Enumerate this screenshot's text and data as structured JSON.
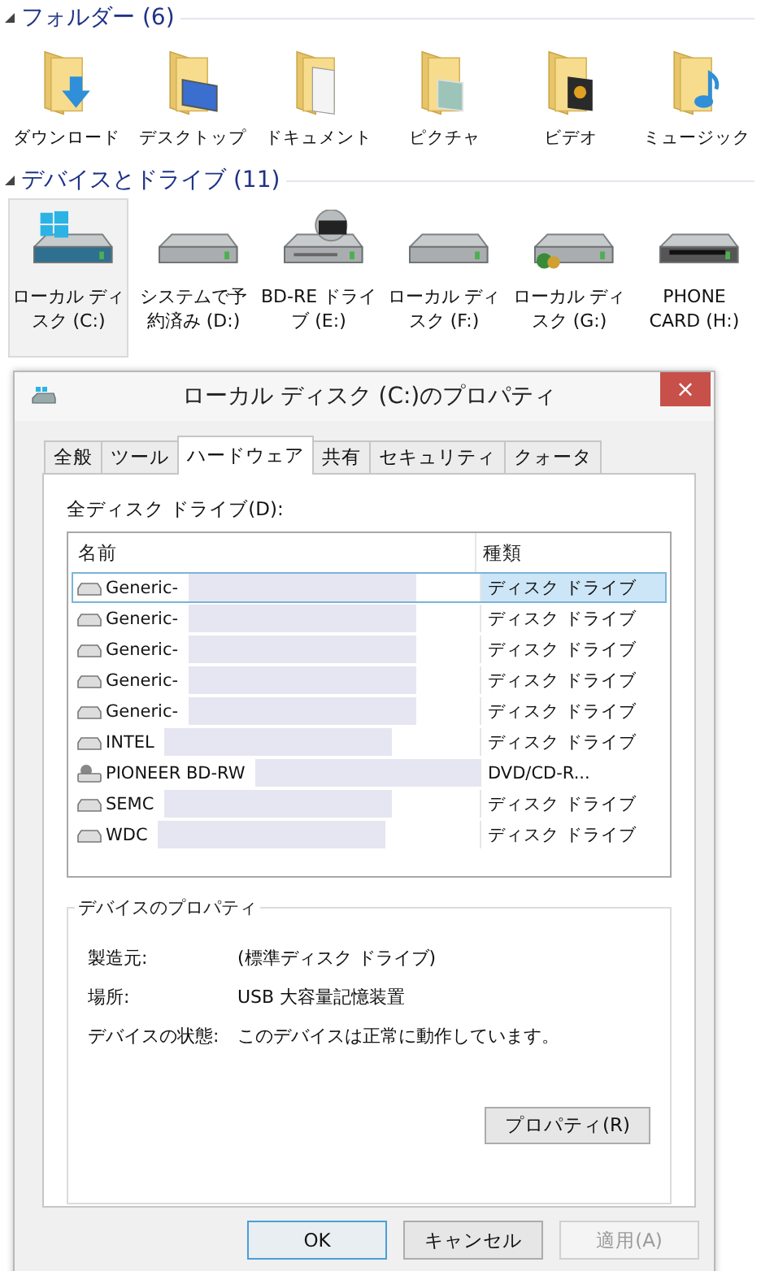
{
  "folders_section": {
    "title": "フォルダー (6)",
    "expanded": true,
    "items": [
      {
        "label": "ダウンロード",
        "kind": "download"
      },
      {
        "label": "デスクトップ",
        "kind": "desktop"
      },
      {
        "label": "ドキュメント",
        "kind": "documents"
      },
      {
        "label": "ピクチャ",
        "kind": "pictures"
      },
      {
        "label": "ビデオ",
        "kind": "videos"
      },
      {
        "label": "ミュージック",
        "kind": "music"
      }
    ]
  },
  "devices_section": {
    "title": "デバイスとドライブ (11)",
    "expanded": true,
    "items": [
      {
        "label": "ローカル ディスク (C:)",
        "kind": "system",
        "selected": true
      },
      {
        "label": "システムで予約済み (D:)",
        "kind": "hdd",
        "selected": false
      },
      {
        "label": "BD-RE ドライブ (E:)",
        "kind": "bd",
        "selected": false
      },
      {
        "label": "ローカル ディスク (F:)",
        "kind": "hdd",
        "selected": false
      },
      {
        "label": "ローカル ディスク (G:)",
        "kind": "shared",
        "selected": false
      },
      {
        "label": "PHONE CARD (H:)",
        "kind": "card",
        "selected": false
      }
    ]
  },
  "dialog": {
    "title": "ローカル ディスク (C:)のプロパティ",
    "close": "×",
    "tabs": [
      {
        "label": "全般",
        "selected": false
      },
      {
        "label": "ツール",
        "selected": false
      },
      {
        "label": "ハードウェア",
        "selected": true
      },
      {
        "label": "共有",
        "selected": false
      },
      {
        "label": "セキュリティ",
        "selected": false
      },
      {
        "label": "クォータ",
        "selected": false
      }
    ],
    "list_label": "全ディスク ドライブ(D):",
    "columns": [
      "名前",
      "種類"
    ],
    "rows": [
      {
        "name": "Generic-",
        "type": "ディスク ドライブ",
        "kind": "disk",
        "selected": true
      },
      {
        "name": "Generic-",
        "type": "ディスク ドライブ",
        "kind": "disk",
        "selected": false
      },
      {
        "name": "Generic-",
        "type": "ディスク ドライブ",
        "kind": "disk",
        "selected": false
      },
      {
        "name": "Generic-",
        "type": "ディスク ドライブ",
        "kind": "disk",
        "selected": false
      },
      {
        "name": "Generic-",
        "type": "ディスク ドライブ",
        "kind": "disk",
        "selected": false
      },
      {
        "name": "INTEL",
        "type": "ディスク ドライブ",
        "kind": "disk",
        "selected": false
      },
      {
        "name": "PIONEER BD-RW",
        "type": "DVD/CD-R...",
        "kind": "optical",
        "selected": false
      },
      {
        "name": "SEMC",
        "type": "ディスク ドライブ",
        "kind": "disk",
        "selected": false
      },
      {
        "name": "WDC",
        "type": "ディスク ドライブ",
        "kind": "disk",
        "selected": false
      }
    ],
    "group_title": "デバイスのプロパティ",
    "properties": [
      {
        "label": "製造元:",
        "value": "(標準ディスク ドライブ)"
      },
      {
        "label": "場所:",
        "value": "USB 大容量記憶装置"
      },
      {
        "label": "デバイスの状態:",
        "value": "このデバイスは正常に動作しています。"
      }
    ],
    "properties_button": "プロパティ(R)",
    "buttons": [
      {
        "label": "OK",
        "disabled": false,
        "default": true
      },
      {
        "label": "キャンセル",
        "disabled": false,
        "default": false
      },
      {
        "label": "適用(A)",
        "disabled": true,
        "default": false
      }
    ]
  }
}
